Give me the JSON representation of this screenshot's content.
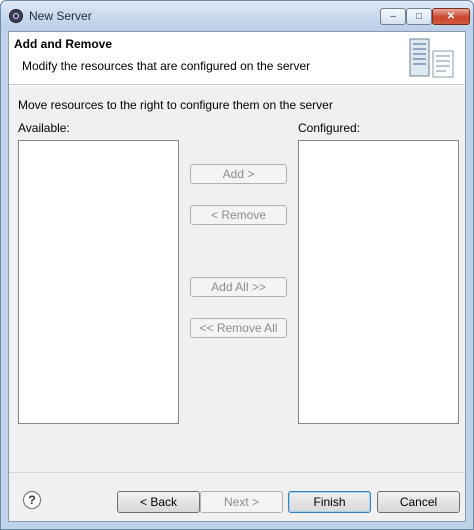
{
  "window": {
    "title": "New Server",
    "controls": {
      "minimize": "–",
      "maximize": "□",
      "close": "✕"
    }
  },
  "header": {
    "title": "Add and Remove",
    "description": "Modify the resources that are configured on the server"
  },
  "body": {
    "instruction": "Move resources to the right to configure them on the server",
    "available_label": "Available:",
    "configured_label": "Configured:",
    "available_items": [],
    "configured_items": []
  },
  "move_buttons": {
    "add": "Add >",
    "remove": "< Remove",
    "add_all": "Add All >>",
    "remove_all": "<< Remove All"
  },
  "footer": {
    "help": "?",
    "back": "< Back",
    "next": "Next >",
    "finish": "Finish",
    "cancel": "Cancel"
  }
}
